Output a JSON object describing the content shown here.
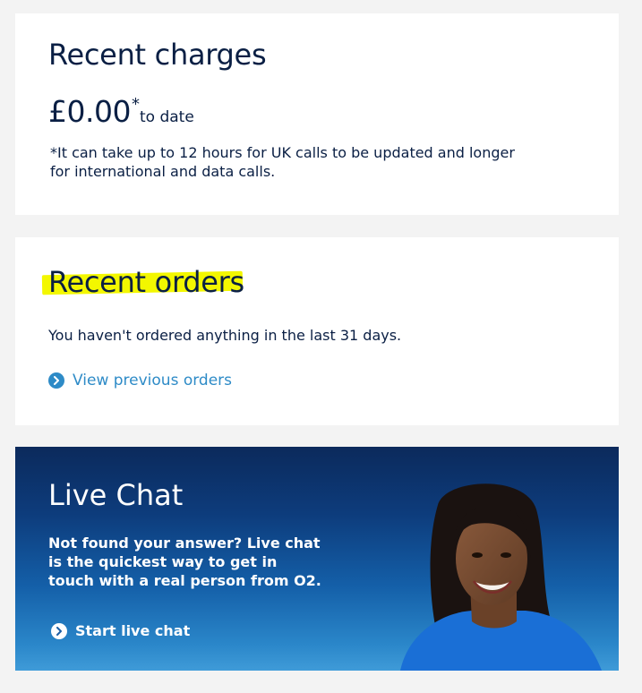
{
  "recent_charges": {
    "title": "Recent charges",
    "amount": "£0.00",
    "asterisk": "*",
    "to_date": "to date",
    "footnote": "*It can take up to 12 hours for UK calls to be updated and longer for international and data calls."
  },
  "recent_orders": {
    "title": "Recent orders",
    "message": "You haven't ordered anything in the last 31 days.",
    "link_label": "View previous orders"
  },
  "live_chat": {
    "title": "Live Chat",
    "text": "Not found your answer? Live chat is the quickest way to get in touch with a real person from O2.",
    "link_label": "Start live chat"
  },
  "icons": {
    "link_icon": "chevron-right-circle-icon"
  },
  "colors": {
    "page_background": "#f3f3f3",
    "heading_text": "#0a1f44",
    "link_blue": "#2e8bc7",
    "highlight_yellow": "#f3f700",
    "banner_top": "#0c2a5c",
    "banner_bottom": "#3f9bd8"
  }
}
